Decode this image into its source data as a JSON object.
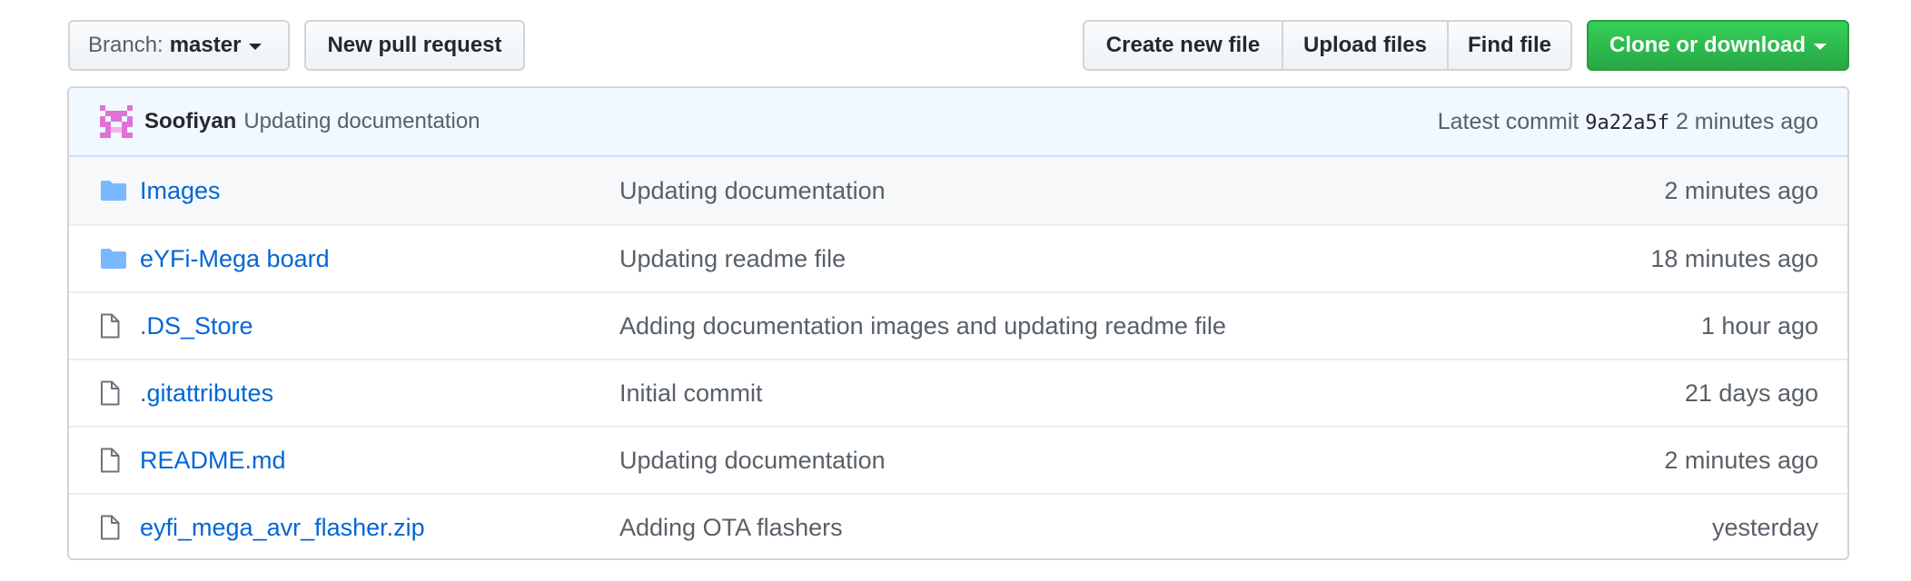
{
  "toolbar": {
    "branch_prefix": "Branch:",
    "branch_name": "master",
    "new_pull_request_label": "New pull request",
    "create_new_file_label": "Create new file",
    "upload_files_label": "Upload files",
    "find_file_label": "Find file",
    "clone_label": "Clone or download"
  },
  "commit": {
    "author": "Soofiyan",
    "message": "Updating documentation",
    "latest_label": "Latest commit",
    "sha": "9a22a5f",
    "age": "2 minutes ago"
  },
  "files": [
    {
      "name": "Images",
      "type": "folder",
      "message": "Updating documentation",
      "age": "2 minutes ago"
    },
    {
      "name": "eYFi-Mega board",
      "type": "folder",
      "message": "Updating readme file",
      "age": "18 minutes ago"
    },
    {
      "name": ".DS_Store",
      "type": "file",
      "message": "Adding documentation images and updating readme file",
      "age": "1 hour ago"
    },
    {
      "name": ".gitattributes",
      "type": "file",
      "message": "Initial commit",
      "age": "21 days ago"
    },
    {
      "name": "README.md",
      "type": "file",
      "message": "Updating documentation",
      "age": "2 minutes ago"
    },
    {
      "name": "eyfi_mega_avr_flasher.zip",
      "type": "file",
      "message": "Adding OTA flashers",
      "age": "yesterday"
    }
  ],
  "icons": {
    "folder": "folder-icon",
    "file": "file-icon",
    "avatar": "identicon-avatar",
    "caret": "caret-down-icon"
  },
  "colors": {
    "link": "#0366d6",
    "muted": "#586069",
    "clone_button": "#28a745",
    "commit_bar_bg": "#f1f8ff",
    "folder_icon": "#79b8ff",
    "avatar": "#e071d6"
  }
}
